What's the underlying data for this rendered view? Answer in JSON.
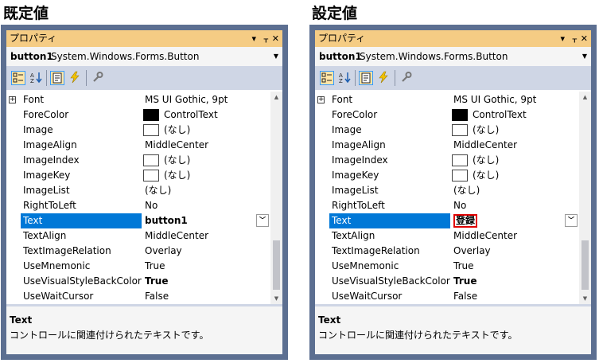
{
  "headings": {
    "left": "既定値",
    "right": "設定値"
  },
  "panel": {
    "title": "プロパティ",
    "title_buttons": [
      "▾",
      "ᚁ",
      "✕"
    ],
    "object_name": "button1",
    "object_type": "System.Windows.Forms.Button",
    "toolbar_icons": [
      "categorized-icon",
      "alphabetical-icon",
      "properties-icon",
      "events-icon",
      "property-pages-icon"
    ],
    "description_title": "Text",
    "description_text": "コントロールに関連付けられたテキストです。"
  },
  "left_rows": [
    {
      "expand": "+",
      "name": "Font",
      "value": "MS UI Gothic, 9pt"
    },
    {
      "name": "ForeColor",
      "swatch": "black",
      "value": "ControlText"
    },
    {
      "name": "Image",
      "swatch": "white",
      "value": "(なし)"
    },
    {
      "name": "ImageAlign",
      "value": "MiddleCenter"
    },
    {
      "name": "ImageIndex",
      "swatch": "white",
      "value": "(なし)"
    },
    {
      "name": "ImageKey",
      "swatch": "white",
      "value": "(なし)"
    },
    {
      "name": "ImageList",
      "value": "(なし)"
    },
    {
      "name": "RightToLeft",
      "value": "No"
    },
    {
      "name": "Text",
      "value": "button1",
      "bold": true,
      "selected": true,
      "dropdown": true
    },
    {
      "name": "TextAlign",
      "value": "MiddleCenter"
    },
    {
      "name": "TextImageRelation",
      "value": "Overlay"
    },
    {
      "name": "UseMnemonic",
      "value": "True"
    },
    {
      "name": "UseVisualStyleBackColor",
      "value": "True",
      "bold": true
    },
    {
      "name": "UseWaitCursor",
      "value": "False"
    }
  ],
  "right_rows": [
    {
      "expand": "+",
      "name": "Font",
      "value": "MS UI Gothic, 9pt"
    },
    {
      "name": "ForeColor",
      "swatch": "black",
      "value": "ControlText"
    },
    {
      "name": "Image",
      "swatch": "white",
      "value": "(なし)"
    },
    {
      "name": "ImageAlign",
      "value": "MiddleCenter"
    },
    {
      "name": "ImageIndex",
      "swatch": "white",
      "value": "(なし)"
    },
    {
      "name": "ImageKey",
      "swatch": "white",
      "value": "(なし)"
    },
    {
      "name": "ImageList",
      "value": "(なし)"
    },
    {
      "name": "RightToLeft",
      "value": "No"
    },
    {
      "name": "Text",
      "value": "登録",
      "bold": true,
      "selected": true,
      "dropdown": true,
      "highlight": true
    },
    {
      "name": "TextAlign",
      "value": "MiddleCenter"
    },
    {
      "name": "TextImageRelation",
      "value": "Overlay"
    },
    {
      "name": "UseMnemonic",
      "value": "True"
    },
    {
      "name": "UseVisualStyleBackColor",
      "value": "True",
      "bold": true
    },
    {
      "name": "UseWaitCursor",
      "value": "False"
    }
  ],
  "colors": {
    "frame": "#5c6f91",
    "titlebar": "#f5cc84",
    "toolbar": "#cfd6e5",
    "selection": "#0078d7",
    "highlight_border": "#e00000"
  }
}
